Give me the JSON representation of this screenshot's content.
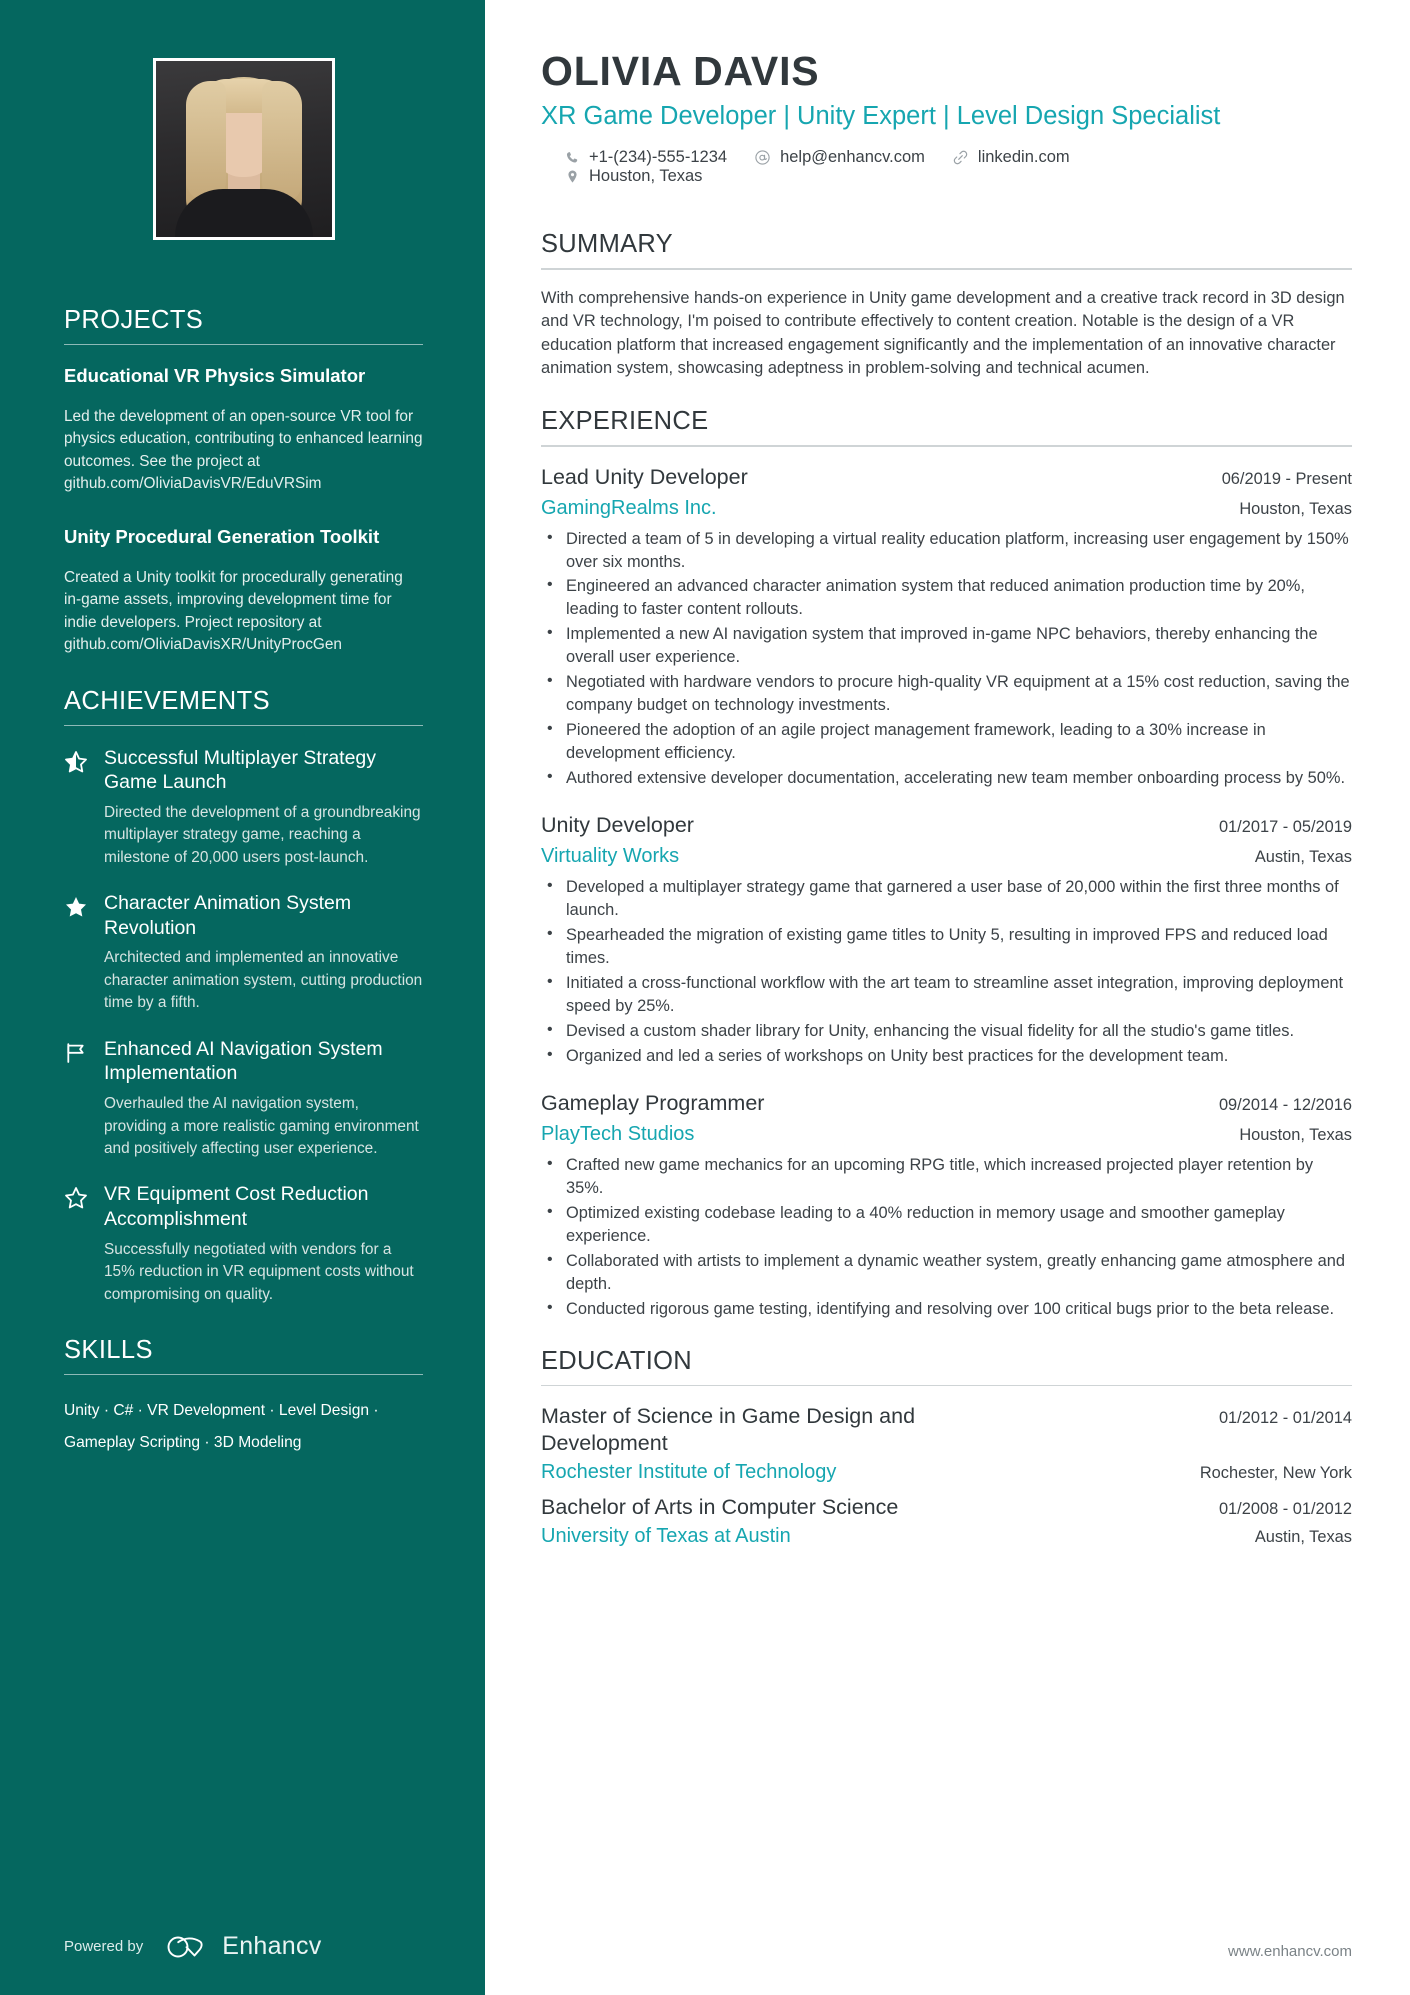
{
  "theme": {
    "sidebar_bg": "#05675F",
    "accent": "#16A6B0",
    "text_dark": "#31383c",
    "body_text": "#3c4247"
  },
  "header": {
    "name": "OLIVIA DAVIS",
    "headline": "XR Game Developer | Unity Expert | Level Design Specialist",
    "contacts": [
      {
        "icon": "phone-icon",
        "text": "+1-(234)-555-1234"
      },
      {
        "icon": "email-icon",
        "text": "help@enhancv.com"
      },
      {
        "icon": "link-icon",
        "text": "linkedin.com"
      },
      {
        "icon": "location-icon",
        "text": "Houston, Texas"
      }
    ]
  },
  "sidebar": {
    "projects": {
      "heading": "PROJECTS",
      "items": [
        {
          "title": "Educational VR Physics Simulator",
          "description": "Led the development of an open-source VR tool for physics education, contributing to enhanced learning outcomes. See the project at github.com/OliviaDavisVR/EduVRSim"
        },
        {
          "title": "Unity Procedural Generation Toolkit",
          "description": "Created a Unity toolkit for procedurally generating in-game assets, improving development time for indie developers. Project repository at github.com/OliviaDavisXR/UnityProcGen"
        }
      ]
    },
    "achievements": {
      "heading": "ACHIEVEMENTS",
      "items": [
        {
          "icon": "half-star-icon",
          "title": "Successful Multiplayer Strategy Game Launch",
          "description": "Directed the development of a groundbreaking multiplayer strategy game, reaching a milestone of 20,000 users post-launch."
        },
        {
          "icon": "star-filled-icon",
          "title": "Character Animation System Revolution",
          "description": "Architected and implemented an innovative character animation system, cutting production time by a fifth."
        },
        {
          "icon": "flag-icon",
          "title": "Enhanced AI Navigation System Implementation",
          "description": "Overhauled the AI navigation system, providing a more realistic gaming environment and positively affecting user experience."
        },
        {
          "icon": "star-outline-icon",
          "title": "VR Equipment Cost Reduction Accomplishment",
          "description": "Successfully negotiated with vendors for a 15% reduction in VR equipment costs without compromising on quality."
        }
      ]
    },
    "skills": {
      "heading": "SKILLS",
      "text": "Unity · C# · VR Development · Level Design · Gameplay Scripting · 3D Modeling"
    },
    "footer": {
      "powered_by": "Powered by",
      "brand": "Enhancv"
    }
  },
  "main": {
    "summary": {
      "heading": "SUMMARY",
      "text": "With comprehensive hands-on experience in Unity game development and a creative track record in 3D design and VR technology, I'm poised to contribute effectively to content creation. Notable is the design of a VR education platform that increased engagement significantly and the implementation of an innovative character animation system, showcasing adeptness in problem-solving and technical acumen."
    },
    "experience": {
      "heading": "EXPERIENCE",
      "jobs": [
        {
          "title": "Lead Unity Developer",
          "date": "06/2019 - Present",
          "company": "GamingRealms Inc.",
          "location": "Houston, Texas",
          "bullets": [
            "Directed a team of 5 in developing a virtual reality education platform, increasing user engagement by 150% over six months.",
            "Engineered an advanced character animation system that reduced animation production time by 20%, leading to faster content rollouts.",
            "Implemented a new AI navigation system that improved in-game NPC behaviors, thereby enhancing the overall user experience.",
            "Negotiated with hardware vendors to procure high-quality VR equipment at a 15% cost reduction, saving the company budget on technology investments.",
            "Pioneered the adoption of an agile project management framework, leading to a 30% increase in development efficiency.",
            "Authored extensive developer documentation, accelerating new team member onboarding process by 50%."
          ]
        },
        {
          "title": "Unity Developer",
          "date": "01/2017 - 05/2019",
          "company": "Virtuality Works",
          "location": "Austin, Texas",
          "bullets": [
            "Developed a multiplayer strategy game that garnered a user base of 20,000 within the first three months of launch.",
            "Spearheaded the migration of existing game titles to Unity 5, resulting in improved FPS and reduced load times.",
            "Initiated a cross-functional workflow with the art team to streamline asset integration, improving deployment speed by 25%.",
            "Devised a custom shader library for Unity, enhancing the visual fidelity for all the studio's game titles.",
            "Organized and led a series of workshops on Unity best practices for the development team."
          ]
        },
        {
          "title": "Gameplay Programmer",
          "date": "09/2014 - 12/2016",
          "company": "PlayTech Studios",
          "location": "Houston, Texas",
          "bullets": [
            "Crafted new game mechanics for an upcoming RPG title, which increased projected player retention by 35%.",
            "Optimized existing codebase leading to a 40% reduction in memory usage and smoother gameplay experience.",
            "Collaborated with artists to implement a dynamic weather system, greatly enhancing game atmosphere and depth.",
            "Conducted rigorous game testing, identifying and resolving over 100 critical bugs prior to the beta release."
          ]
        }
      ]
    },
    "education": {
      "heading": "EDUCATION",
      "items": [
        {
          "degree": "Master of Science in Game Design and Development",
          "date": "01/2012 - 01/2014",
          "school": "Rochester Institute of Technology",
          "location": "Rochester, New York"
        },
        {
          "degree": "Bachelor of Arts in Computer Science",
          "date": "01/2008 - 01/2012",
          "school": "University of Texas at Austin",
          "location": "Austin, Texas"
        }
      ]
    },
    "footer": {
      "site": "www.enhancv.com"
    }
  }
}
